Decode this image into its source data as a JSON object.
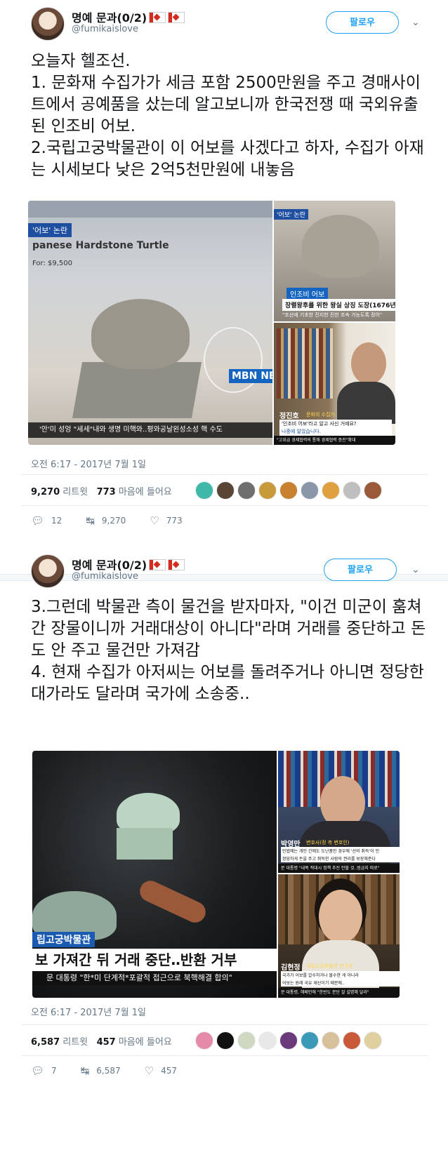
{
  "tweets": [
    {
      "author": {
        "name": "명예 문과(0/2)",
        "handle": "@fumikaislove",
        "avatar_icon": "anime-avatar-icon",
        "flag_icon": "canada-flag-icon"
      },
      "follow_label": "팔로우",
      "text": "오늘자 헬조선.\n1. 문화재 수집가가 세금 포함 2500만원을 주고 경매사이트에서 공예품을 샀는데 알고보니까 한국전쟁 때 국외유출된 인조비 어보.\n2.국립고궁박물관이 이 어보를 사겠다고 하자, 수집가 아재는 시세보다 낮은 2억5천만원에 내놓음",
      "media": {
        "main_caption_tag": "'어보' 논란",
        "main_listing_title": "panese Hardstone Turtle",
        "main_price": "For: $9,500",
        "main_ticker": "'안'미 성엉 \"세세\"내와 생명 미핵와..평와공날왼성소성 핵 수도",
        "logo": "MBN NEWS",
        "right_top_tag": "'어보' 논란",
        "right_top_label": "인조비 어보",
        "right_top_title": "장렬왕후를 위한 왕실 상징 도장(1676년)",
        "right_top_sub": "\"조선에 기초한 진지한 진한 조속 가능도록 정어\"",
        "right_bottom_name": "정진호",
        "right_bottom_role": "문화의 수집가",
        "right_bottom_quote1": "'인조비 어보'라고 알고 사신 거예요?",
        "right_bottom_quote2": "나중에 알았습니다.",
        "right_bottom_ticker": "\"고위급 경제협력의 통해 경제협력 증진\"확대"
      },
      "timestamp": "오전 6:17 - 2017년 7월 1일",
      "retweets_count": "9,270",
      "retweets_label": "리트윗",
      "likes_count": "773",
      "likes_label": "마음에 들어요",
      "actions": {
        "reply": "12",
        "retweet": "9,270",
        "like": "773"
      },
      "liker_colors": [
        "#3fb8a9",
        "#5a4535",
        "#6e6e6e",
        "#c99a3a",
        "#c7812f",
        "#8a97a8",
        "#e0a040",
        "#bfbfbf",
        "#9a5a3a"
      ]
    },
    {
      "author": {
        "name": "명예 문과(0/2)",
        "handle": "@fumikaislove",
        "avatar_icon": "anime-avatar-icon",
        "flag_icon": "canada-flag-icon"
      },
      "follow_label": "팔로우",
      "text": "3.그런데 박물관 측이 물건을 받자마자, \"이건 미군이 훔쳐간 장물이니까 거래대상이 아니다\"라며 거래를 중단하고 돈도 안 주고 물건만 가져감\n4. 현재 수집가 아저씨는 어보를 돌려주거나 아니면 정당한 대가라도 달라며 국가에 소송중..",
      "media": {
        "main_tag": "립고궁박물관",
        "main_headline": "보 가져간 뒤 거래 중단‥반환 거부",
        "main_ticker": "문 대통령 \"한*미 단계적*포괄적 접근으로 북핵해결 합의\"",
        "right_top_name": "박영만",
        "right_top_role": "변호사(정 측 변호인)",
        "right_top_quote1": "민법에는 개인 간에도 도난품인 경우에 '선의 취득'이 인",
        "right_top_quote2": "정당하게 돈을 주고 취득한 사람의 권리를 보장해준다",
        "right_top_ticker": "문 대통령 \"내복 적대시 정책 추진 안할 것..범금지 따로\"",
        "right_bottom_name": "김현정",
        "right_bottom_role": "국립고궁박물관 연구관",
        "right_bottom_quote1": "국가가 어보를 압수하거나 몰수한 게 아니라",
        "right_bottom_quote2": "어보는 원래 국유 재산이기 때문에..",
        "right_bottom_ticker": "문 대통령, 해배인에 \"한반도 분단 잘 설명해 달라\""
      },
      "timestamp": "오전 6:17 - 2017년 7월 1일",
      "retweets_count": "6,587",
      "retweets_label": "리트윗",
      "likes_count": "457",
      "likes_label": "마음에 들어요",
      "actions": {
        "reply": "7",
        "retweet": "6,587",
        "like": "457"
      },
      "liker_colors": [
        "#e58aa8",
        "#111111",
        "#cfd8c0",
        "#e8e8e8",
        "#6a3a7a",
        "#3a9ab8",
        "#d8c09a",
        "#c85a3a",
        "#e0d0a0"
      ]
    }
  ]
}
